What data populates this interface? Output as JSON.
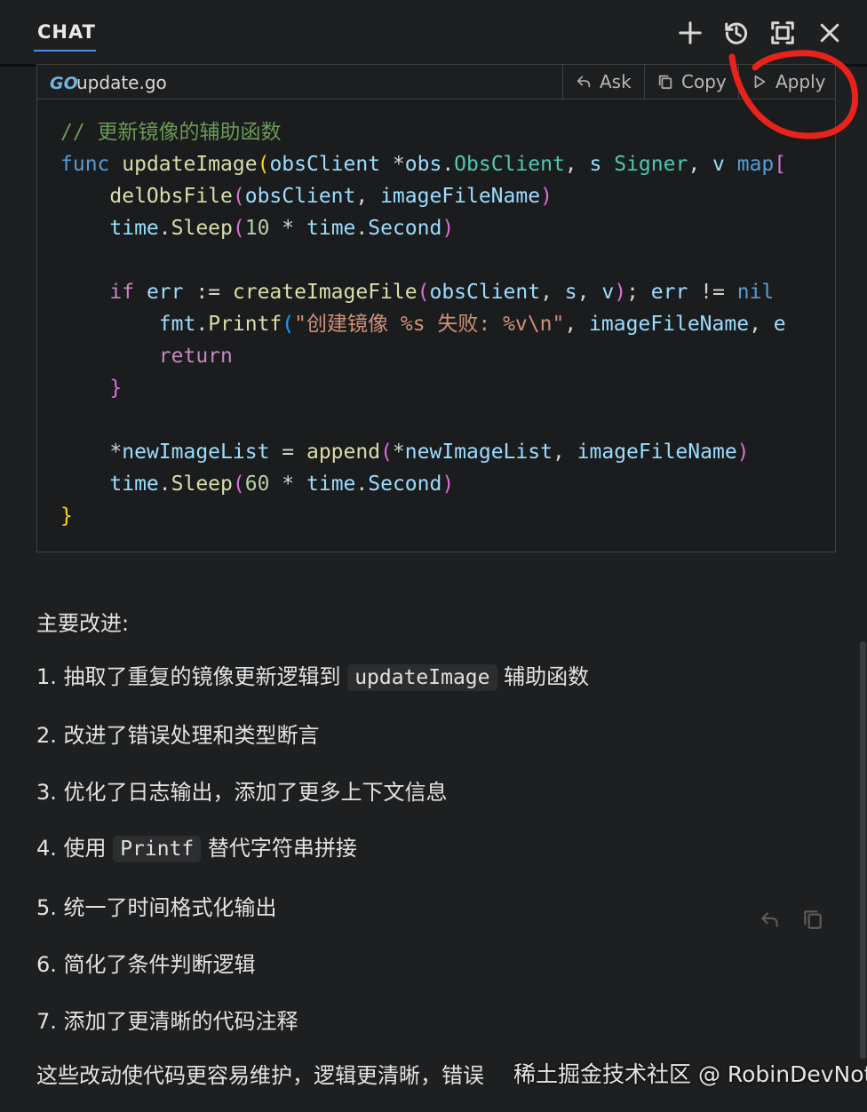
{
  "header": {
    "tab_label": "CHAT",
    "icons": [
      "plus-icon",
      "history-icon",
      "maximize-icon",
      "close-icon"
    ]
  },
  "code_block": {
    "file_name": "update.go",
    "language_logo": "GO",
    "ask_label": "Ask",
    "copy_label": "Copy",
    "apply_label": "Apply",
    "code_comment": "更新镜像的辅助函数",
    "format_string": "创建镜像 %s 失败: %v\\n"
  },
  "explanation": {
    "heading": "主要改进:",
    "items": [
      {
        "num": "1.",
        "before": "抽取了重复的镜像更新逻辑到",
        "code": "updateImage",
        "after": "辅助函数"
      },
      {
        "num": "2.",
        "text": "改进了错误处理和类型断言"
      },
      {
        "num": "3.",
        "text": "优化了日志输出，添加了更多上下文信息"
      },
      {
        "num": "4.",
        "before": "使用",
        "code": "Printf",
        "after": "替代字符串拼接"
      },
      {
        "num": "5.",
        "text": "统一了时间格式化输出"
      },
      {
        "num": "6.",
        "text": "简化了条件判断逻辑"
      },
      {
        "num": "7.",
        "text": "添加了更清晰的代码注释"
      }
    ],
    "summary": "这些改动使代码更容易维护，逻辑更清晰，错误"
  },
  "watermark": "稀土掘金技术社区 @ RobinDevNotes",
  "colors": {
    "background": "#1e1f20",
    "tab_underline": "#4a8fe7",
    "annotation_circle": "#e8231c"
  }
}
